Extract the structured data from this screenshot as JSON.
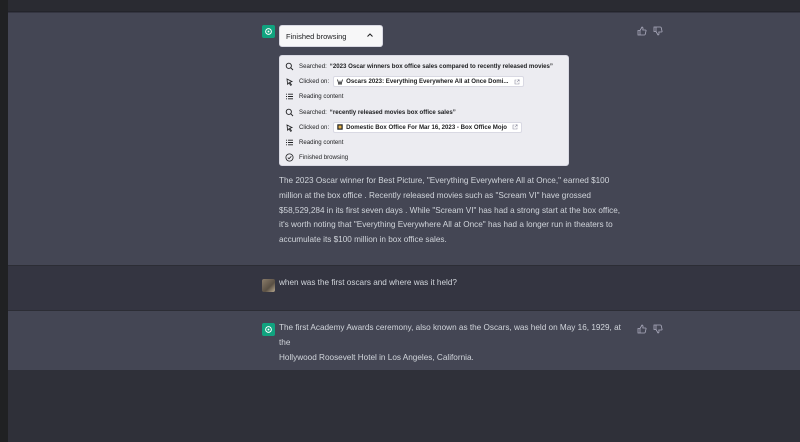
{
  "browsing": {
    "toggle_label": "Finished browsing",
    "steps": [
      {
        "type": "search",
        "prefix": "Searched:",
        "query": "“2023 Oscar winners box office sales compared to recently released movies”"
      },
      {
        "type": "click",
        "prefix": "Clicked on:",
        "link": "Oscars 2023: Everything Everywhere All at Once Domi..."
      },
      {
        "type": "reading",
        "prefix": "Reading content"
      },
      {
        "type": "search",
        "prefix": "Searched:",
        "query": "“recently released movies box office sales”"
      },
      {
        "type": "click",
        "prefix": "Clicked on:",
        "link": "Domestic Box Office For Mar 16, 2023 - Box Office Mojo"
      },
      {
        "type": "reading",
        "prefix": "Reading content"
      },
      {
        "type": "done",
        "prefix": "Finished browsing"
      }
    ]
  },
  "messages": [
    {
      "role": "assistant",
      "lines": [
        "The 2023 Oscar winner for Best Picture, \"Everything Everywhere All at Once,\" earned $100",
        "million at the box office . Recently released movies such as \"Scream VI\" have grossed",
        "$58,529,284 in its first seven days . While \"Scream VI\" has had a strong start at the box office,",
        "it's worth noting that \"Everything Everywhere All at Once\" has had a longer run in theaters to",
        "accumulate its $100 million in box office sales."
      ]
    },
    {
      "role": "user",
      "lines": [
        "when was the first oscars and where was it held?"
      ]
    },
    {
      "role": "assistant",
      "lines": [
        "The first Academy Awards ceremony, also known as the Oscars, was held on May 16, 1929, at the",
        "Hollywood Roosevelt Hotel in Los Angeles, California."
      ]
    }
  ],
  "icons": {
    "assistant_avatar": "openai-logo-icon",
    "thumbs_up": "thumbs-up-icon",
    "thumbs_down": "thumbs-down-icon",
    "search": "search-icon",
    "click": "cursor-click-icon",
    "reading": "list-icon",
    "done": "check-circle-icon",
    "external": "external-link-icon",
    "chevron": "chevron-up-icon"
  },
  "colors": {
    "assistant_bg": "#444654",
    "user_bg": "#343541",
    "brand_green": "#10a37f"
  }
}
